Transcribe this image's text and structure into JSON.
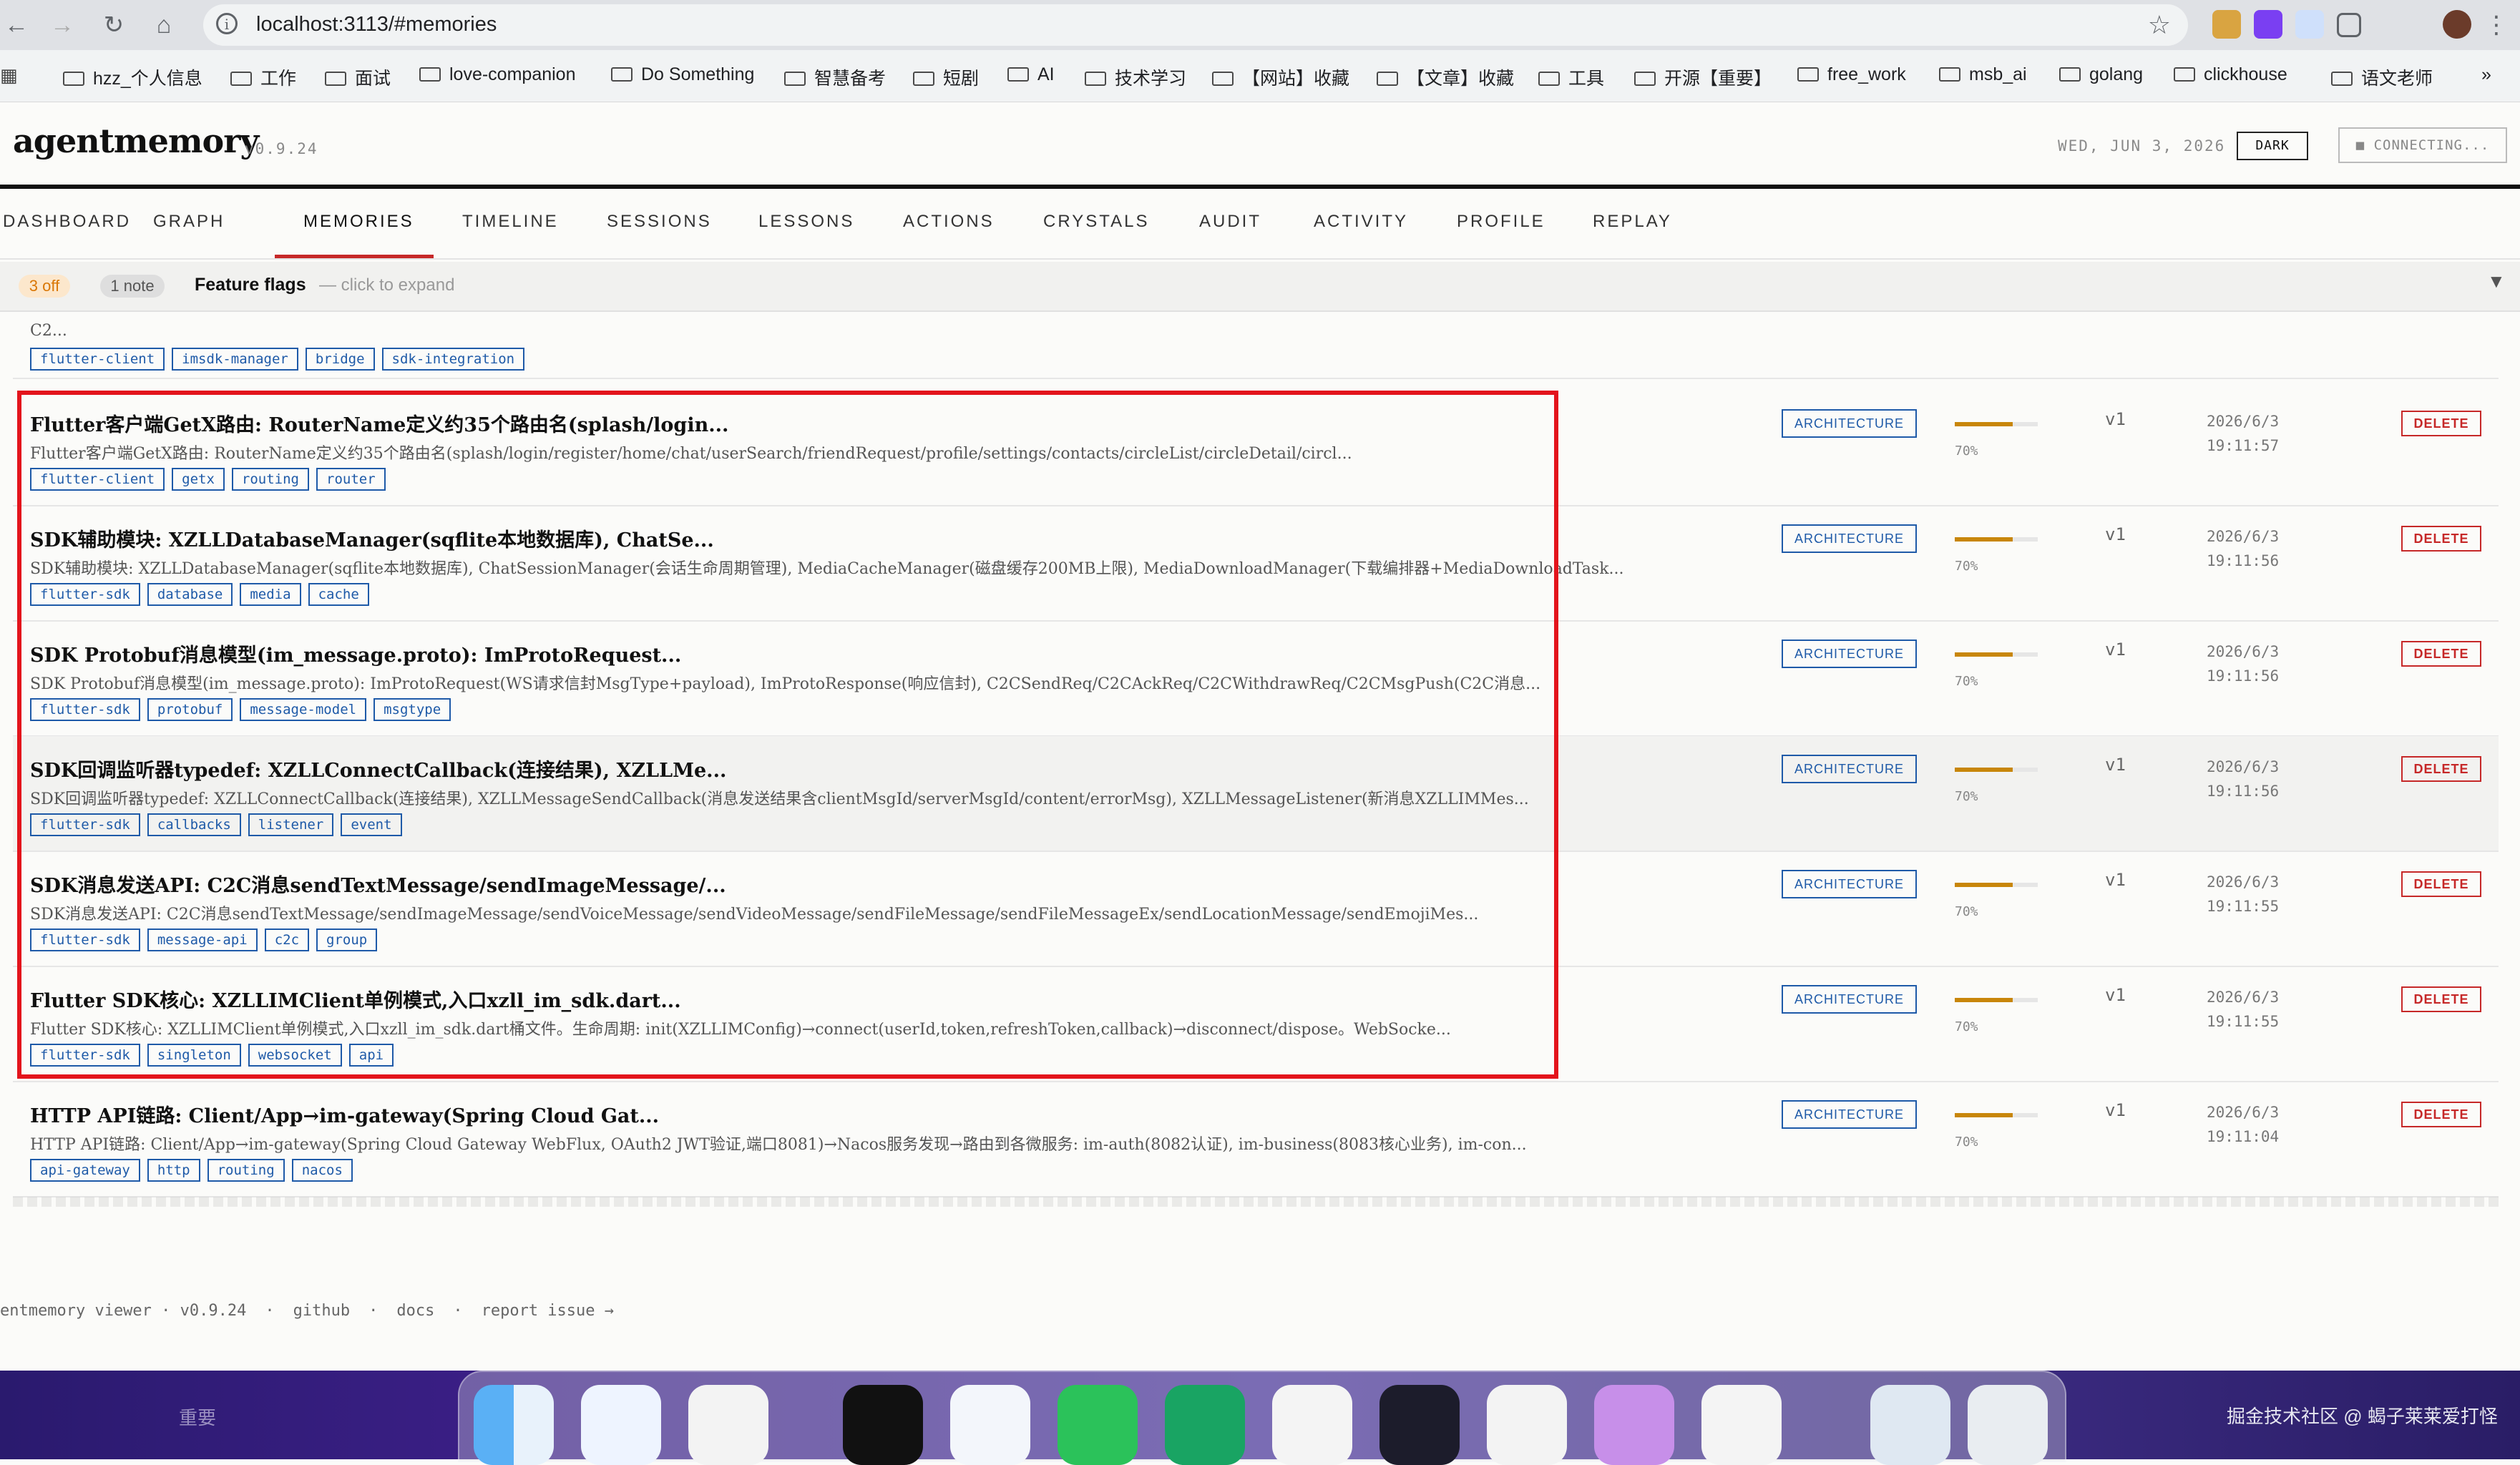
{
  "browser": {
    "url": "localhost:3113/#memories",
    "bookmarks": [
      "hzz_个人信息",
      "工作",
      "面试",
      "love-companion",
      "Do Something",
      "智慧备考",
      "短剧",
      "AI",
      "技术学习",
      "【网站】收藏",
      "【文章】收藏",
      "工具",
      "开源【重要】",
      "free_work",
      "msb_ai",
      "golang",
      "clickhouse",
      "语文老师"
    ],
    "overflow": "»"
  },
  "app": {
    "brand": "agentmemory",
    "version": "v0.9.24",
    "date": "WED, JUN 3, 2026",
    "theme_button": "DARK",
    "status_button": "■ CONNECTING..."
  },
  "tabs": [
    "DASHBOARD",
    "GRAPH",
    "MEMORIES",
    "TIMELINE",
    "SESSIONS",
    "LESSONS",
    "ACTIONS",
    "CRYSTALS",
    "AUDIT",
    "ACTIVITY",
    "PROFILE",
    "REPLAY"
  ],
  "active_tab": "MEMORIES",
  "flags": {
    "off_badge": "3 off",
    "note_badge": "1 note",
    "title": "Feature flags",
    "hint": "— click to expand",
    "caret": "▼"
  },
  "partial_row": {
    "desc": "C2...",
    "tags": [
      "flutter-client",
      "imsdk-manager",
      "bridge",
      "sdk-integration"
    ]
  },
  "memories": [
    {
      "title": "Flutter客户端GetX路由: RouterName定义约35个路由名(splash/login...",
      "desc": "Flutter客户端GetX路由: RouterName定义约35个路由名(splash/login/register/home/chat/userSearch/friendRequest/profile/settings/contacts/circleList/circleDetail/circl...",
      "tags": [
        "flutter-client",
        "getx",
        "routing",
        "router"
      ],
      "type": "ARCHITECTURE",
      "confidence_label": "70%",
      "confidence": 0.7,
      "version": "v1",
      "date": "2026/6/3",
      "time": "19:11:57",
      "delete": "DELETE"
    },
    {
      "title": "SDK辅助模块: XZLLDatabaseManager(sqflite本地数据库), ChatSe...",
      "desc": "SDK辅助模块: XZLLDatabaseManager(sqflite本地数据库), ChatSessionManager(会话生命周期管理), MediaCacheManager(磁盘缓存200MB上限), MediaDownloadManager(下载编排器+MediaDownloadTask...",
      "tags": [
        "flutter-sdk",
        "database",
        "media",
        "cache"
      ],
      "type": "ARCHITECTURE",
      "confidence_label": "70%",
      "confidence": 0.7,
      "version": "v1",
      "date": "2026/6/3",
      "time": "19:11:56",
      "delete": "DELETE"
    },
    {
      "title": "SDK Protobuf消息模型(im_message.proto): ImProtoRequest...",
      "desc": "SDK Protobuf消息模型(im_message.proto): ImProtoRequest(WS请求信封MsgType+payload), ImProtoResponse(响应信封), C2CSendReq/C2CAckReq/C2CWithdrawReq/C2CMsgPush(C2C消息...",
      "tags": [
        "flutter-sdk",
        "protobuf",
        "message-model",
        "msgtype"
      ],
      "type": "ARCHITECTURE",
      "confidence_label": "70%",
      "confidence": 0.7,
      "version": "v1",
      "date": "2026/6/3",
      "time": "19:11:56",
      "delete": "DELETE"
    },
    {
      "title": "SDK回调监听器typedef: XZLLConnectCallback(连接结果), XZLLMe...",
      "desc": "SDK回调监听器typedef: XZLLConnectCallback(连接结果), XZLLMessageSendCallback(消息发送结果含clientMsgId/serverMsgId/content/errorMsg), XZLLMessageListener(新消息XZLLIMMes...",
      "tags": [
        "flutter-sdk",
        "callbacks",
        "listener",
        "event"
      ],
      "type": "ARCHITECTURE",
      "confidence_label": "70%",
      "confidence": 0.7,
      "version": "v1",
      "date": "2026/6/3",
      "time": "19:11:56",
      "delete": "DELETE"
    },
    {
      "title": "SDK消息发送API: C2C消息sendTextMessage/sendImageMessage/...",
      "desc": "SDK消息发送API: C2C消息sendTextMessage/sendImageMessage/sendVoiceMessage/sendVideoMessage/sendFileMessage/sendFileMessageEx/sendLocationMessage/sendEmojiMes...",
      "tags": [
        "flutter-sdk",
        "message-api",
        "c2c",
        "group"
      ],
      "type": "ARCHITECTURE",
      "confidence_label": "70%",
      "confidence": 0.7,
      "version": "v1",
      "date": "2026/6/3",
      "time": "19:11:55",
      "delete": "DELETE"
    },
    {
      "title": "Flutter SDK核心: XZLLIMClient单例模式,入口xzll_im_sdk.dart...",
      "desc": "Flutter SDK核心: XZLLIMClient单例模式,入口xzll_im_sdk.dart桶文件。生命周期: init(XZLLIMConfig)→connect(userId,token,refreshToken,callback)→disconnect/dispose。WebSocke...",
      "tags": [
        "flutter-sdk",
        "singleton",
        "websocket",
        "api"
      ],
      "type": "ARCHITECTURE",
      "confidence_label": "70%",
      "confidence": 0.7,
      "version": "v1",
      "date": "2026/6/3",
      "time": "19:11:55",
      "delete": "DELETE"
    },
    {
      "title": "HTTP API链路: Client/App→im-gateway(Spring Cloud Gat...",
      "desc": "HTTP API链路: Client/App→im-gateway(Spring Cloud Gateway WebFlux, OAuth2 JWT验证,端口8081)→Nacos服务发现→路由到各微服务: im-auth(8082认证), im-business(8083核心业务), im-con...",
      "tags": [
        "api-gateway",
        "http",
        "routing",
        "nacos"
      ],
      "type": "ARCHITECTURE",
      "confidence_label": "70%",
      "confidence": 0.7,
      "version": "v1",
      "date": "2026/6/3",
      "time": "19:11:04",
      "delete": "DELETE"
    }
  ],
  "footer": [
    "entmemory viewer · v0.9.24",
    "·",
    "github",
    "·",
    "docs",
    "·",
    "report issue →"
  ],
  "dock": {
    "left_text": "重要",
    "watermark": "掘金技术社区 @ 蝎子莱莱爱打怪"
  }
}
